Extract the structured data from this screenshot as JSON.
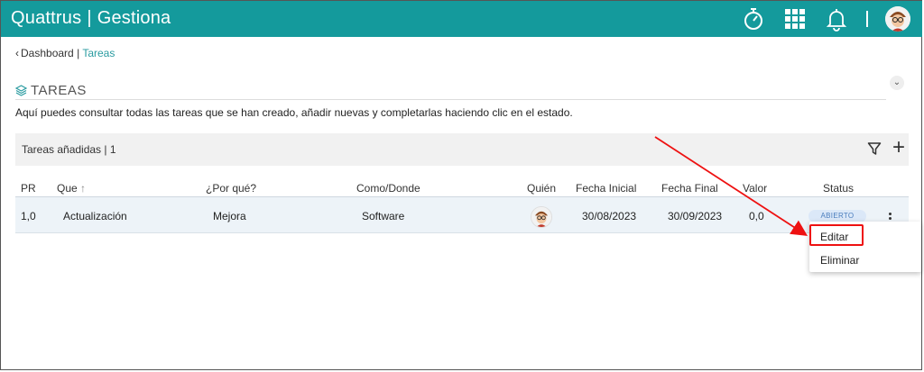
{
  "app": {
    "brand_left": "Quattrus",
    "brand_sep": "|",
    "brand_right": "Gestiona"
  },
  "topbar": {
    "icons": [
      "stopwatch-icon",
      "apps-grid-icon",
      "bell-icon",
      "avatar"
    ]
  },
  "breadcrumb": {
    "parent": "Dashboard",
    "sep": "|",
    "current": "Tareas"
  },
  "section": {
    "title": "TAREAS",
    "description": "Aquí puedes consultar todas las tareas que se han creado, añadir nuevas y completarlas haciendo clic en el estado."
  },
  "panel": {
    "title": "Tareas añadidas | 1"
  },
  "table": {
    "headers": {
      "pr": "PR",
      "que": "Que",
      "por_que": "¿Por qué?",
      "como": "Como/Donde",
      "quien": "Quién",
      "fecha_inicial": "Fecha Inicial",
      "fecha_final": "Fecha Final",
      "valor": "Valor",
      "status": "Status"
    },
    "rows": [
      {
        "pr": "1,0",
        "que": "Actualización",
        "por_que": "Mejora",
        "como": "Software",
        "fecha_inicial": "30/08/2023",
        "fecha_final": "30/09/2023",
        "valor": "0,0",
        "status": "ABIERTO"
      }
    ]
  },
  "context_menu": {
    "items": [
      "Editar",
      "Eliminar"
    ]
  },
  "colors": {
    "topbar": "#149a9c",
    "accent": "#2a9ba0",
    "highlight": "#e11111",
    "badge_bg": "#dbe8f8",
    "badge_text": "#4a7dbd"
  }
}
